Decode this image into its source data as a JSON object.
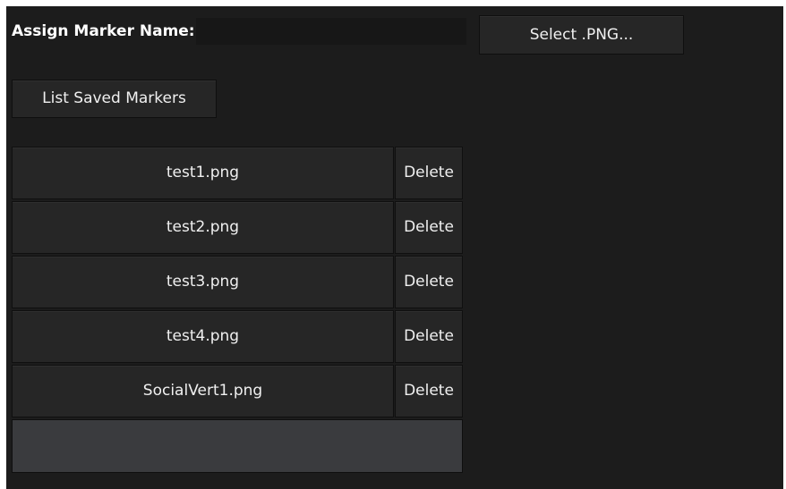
{
  "marker_form": {
    "name_label": "Assign Marker Name:",
    "name_value": "",
    "select_button_label": "Select .PNG..."
  },
  "list_button_label": "List Saved Markers",
  "markers": [
    {
      "filename": "test1.png",
      "delete_label": "Delete"
    },
    {
      "filename": "test2.png",
      "delete_label": "Delete"
    },
    {
      "filename": "test3.png",
      "delete_label": "Delete"
    },
    {
      "filename": "test4.png",
      "delete_label": "Delete"
    },
    {
      "filename": "SocialVert1.png",
      "delete_label": "Delete"
    }
  ],
  "colors": {
    "panel_background": "#1c1c1c",
    "button_background": "#262626",
    "input_background": "#171717",
    "empty_slot": "#3a3b3e",
    "text": "#f0f0f0"
  }
}
